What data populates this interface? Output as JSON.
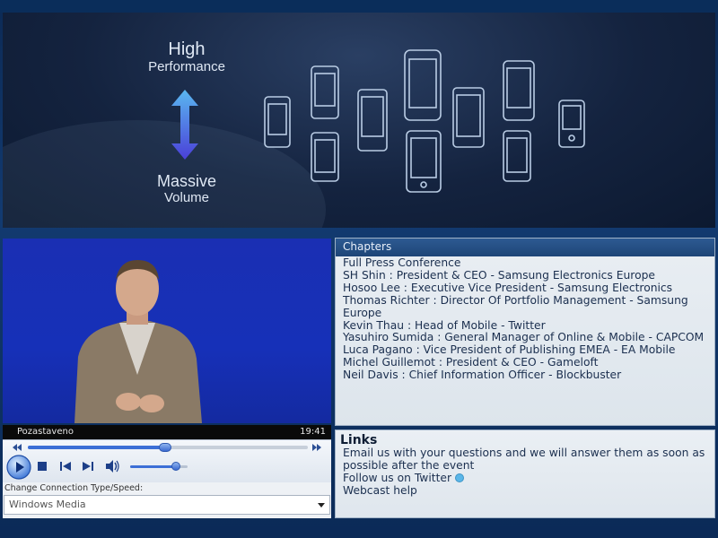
{
  "slide": {
    "top_label_line1": "High",
    "top_label_line2": "Performance",
    "bottom_label_line1": "Massive",
    "bottom_label_line2": "Volume"
  },
  "player": {
    "status": "Pozastaveno",
    "time": "19:41",
    "progress_fraction": 0.49,
    "volume_fraction": 0.8,
    "connection_label": "Change Connection Type/Speed:",
    "connection_value": "Windows Media"
  },
  "chapters": {
    "title": "Chapters",
    "items": [
      "Full Press Conference",
      "SH Shin : President & CEO - Samsung Electronics Europe",
      "Hosoo Lee : Executive Vice President - Samsung Electronics",
      "Thomas Richter : Director Of Portfolio Management - Samsung Europe",
      "Kevin Thau : Head of Mobile - Twitter",
      "Yasuhiro Sumida : General Manager of Online & Mobile - CAPCOM",
      "Luca Pagano : Vice President of Publishing EMEA - EA Mobile",
      "Michel Guillemot : President & CEO - Gameloft",
      "Neil Davis : Chief Information Officer - Blockbuster"
    ]
  },
  "links": {
    "title": "Links",
    "items": [
      "Email us with your questions and we will answer them as soon as possible after the event",
      "Follow us on Twitter",
      "Webcast help"
    ]
  },
  "colors": {
    "background": "#123a70",
    "panel_header": "#2d5a92",
    "video_backdrop": "#1630b8",
    "accent": "#3c6fd6"
  }
}
